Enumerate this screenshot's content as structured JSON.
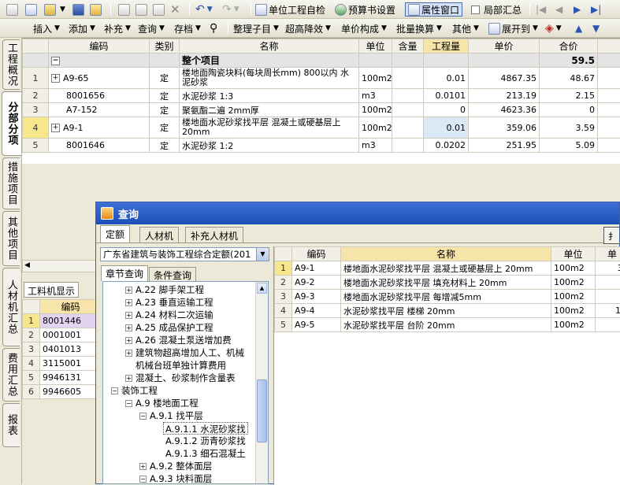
{
  "toolbar1": {
    "self_check": "单位工程自检",
    "budget_settings": "预算书设置",
    "property_window": "属性窗口",
    "partial_summary": "局部汇总"
  },
  "toolbar2": {
    "insert": "插入",
    "add": "添加",
    "supplement": "补充",
    "query": "查询",
    "save": "存档",
    "organize": "整理子目",
    "over_height": "超高降效",
    "price_composition": "单价构成",
    "batch_convert": "批量换算",
    "other": "其他",
    "expand": "展开到"
  },
  "sidebar": [
    "工程概况",
    "分部分项",
    "措施项目",
    "其他项目",
    "人材机汇总",
    "费用汇总",
    "报表"
  ],
  "main_grid": {
    "headers": [
      "编码",
      "类别",
      "名称",
      "单位",
      "含量",
      "工程量",
      "单价",
      "合价"
    ],
    "group": {
      "label": "整个项目",
      "total": "59.5",
      "toggle": "−"
    },
    "rows": [
      {
        "no": "1",
        "code": "A9-65",
        "type": "定",
        "name": "楼地面陶瓷块料(每块周长mm) 800以内 水泥砂浆",
        "unit": "100m2",
        "content": "",
        "qty": "0.01",
        "price": "4867.35",
        "total": "48.67",
        "expand": "+"
      },
      {
        "no": "2",
        "code": "8001656",
        "type": "定",
        "name": "水泥砂浆 1:3",
        "unit": "m3",
        "content": "",
        "qty": "0.0101",
        "price": "213.19",
        "total": "2.15"
      },
      {
        "no": "3",
        "code": "A7-152",
        "type": "定",
        "name": "聚氨酯二遍 2mm厚",
        "unit": "100m2",
        "content": "",
        "qty": "0",
        "price": "4623.36",
        "total": "0"
      },
      {
        "no": "4",
        "code": "A9-1",
        "type": "定",
        "name": "楼地面水泥砂浆找平层 混凝土或硬基层上 20mm",
        "unit": "100m2",
        "content": "",
        "qty": "0.01",
        "price": "359.06",
        "total": "3.59",
        "expand": "+"
      },
      {
        "no": "5",
        "code": "8001646",
        "type": "定",
        "name": "水泥砂浆 1:2",
        "unit": "m3",
        "content": "",
        "qty": "0.0202",
        "price": "251.95",
        "total": "5.09"
      }
    ]
  },
  "lower_left": {
    "tab": "工料机显示",
    "header": "编码",
    "rows": [
      {
        "no": "1",
        "code": "8001446"
      },
      {
        "no": "2",
        "code": "0001001"
      },
      {
        "no": "3",
        "code": "0401013"
      },
      {
        "no": "4",
        "code": "3115001"
      },
      {
        "no": "5",
        "code": "9946131"
      },
      {
        "no": "6",
        "code": "9946605"
      }
    ]
  },
  "dialog": {
    "title": "查询",
    "tabs": [
      "定额",
      "人材机",
      "补充人材机"
    ],
    "quota_lib": "广东省建筑与装饰工程综合定额(201",
    "subtabs": [
      "章节查询",
      "条件查询"
    ],
    "tree": [
      {
        "text": "A.22 脚手架工程",
        "box": "+"
      },
      {
        "text": "A.23 垂直运输工程",
        "box": "+"
      },
      {
        "text": "A.24 材料二次运输",
        "box": "+"
      },
      {
        "text": "A.25 成品保护工程",
        "box": "+"
      },
      {
        "text": "A.26 混凝土泵送增加费",
        "box": "+"
      },
      {
        "text": "建筑物超高增加人工、机械",
        "box": "+"
      },
      {
        "text": "机械台班单独计算费用",
        "box": ""
      },
      {
        "text": "混凝土、砂浆制作含量表",
        "box": "+"
      },
      {
        "text": "装饰工程",
        "box": "−"
      },
      {
        "text": "A.9 楼地面工程",
        "box": "−"
      },
      {
        "text": "A.9.1 找平层",
        "box": "−"
      },
      {
        "text": "A.9.1.1 水泥砂浆找",
        "box": ""
      },
      {
        "text": "A.9.1.2 沥青砂浆找",
        "box": ""
      },
      {
        "text": "A.9.1.3 细石混凝土",
        "box": ""
      },
      {
        "text": "A.9.2 整体面层",
        "box": "+"
      },
      {
        "text": "A.9.3 块料面层",
        "box": "−"
      }
    ],
    "grid": {
      "headers": [
        "编码",
        "名称",
        "单位",
        "单"
      ],
      "rows": [
        {
          "no": "1",
          "code": "A9-1",
          "name": "楼地面水泥砂浆找平层 混凝土或硬基层上 20mm",
          "unit": "100m2",
          "price": "3!"
        },
        {
          "no": "2",
          "code": "A9-2",
          "name": "楼地面水泥砂浆找平层 填充材料上 20mm",
          "unit": "100m2",
          "price": "3"
        },
        {
          "no": "3",
          "code": "A9-3",
          "name": "楼地面水泥砂浆找平层 每增减5mm",
          "unit": "100m2",
          "price": ""
        },
        {
          "no": "4",
          "code": "A9-4",
          "name": "水泥砂浆找平层 楼梯 20mm",
          "unit": "100m2",
          "price": "13"
        },
        {
          "no": "5",
          "code": "A9-5",
          "name": "水泥砂浆找平层 台阶 20mm",
          "unit": "100m2",
          "price": "9"
        }
      ]
    }
  }
}
